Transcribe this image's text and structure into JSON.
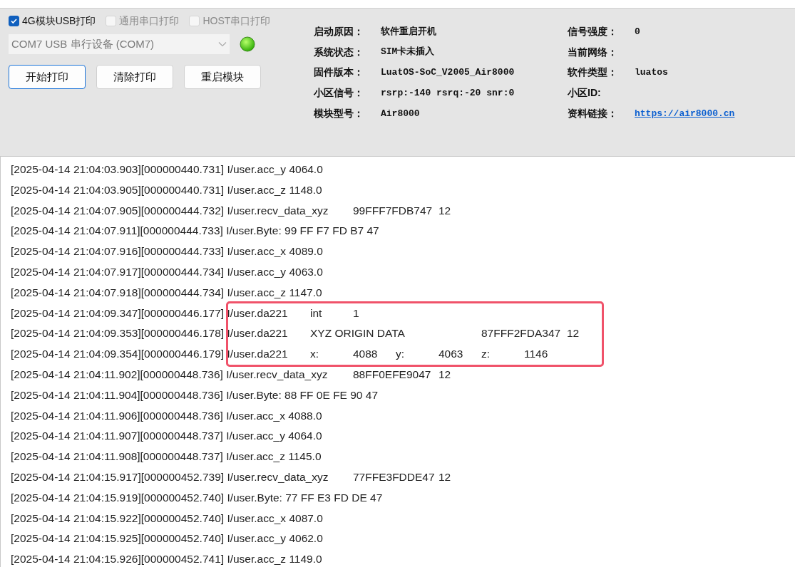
{
  "print_options": [
    {
      "label": "4G模块USB打印",
      "checked": true,
      "disabled": false
    },
    {
      "label": "通用串口打印",
      "checked": false,
      "disabled": true
    },
    {
      "label": "HOST串口打印",
      "checked": false,
      "disabled": true
    }
  ],
  "port_select": {
    "value": "COM7 USB 串行设备 (COM7)",
    "disabled": true
  },
  "status_led": {
    "on": true
  },
  "buttons": [
    {
      "label": "开始打印",
      "selected": true
    },
    {
      "label": "清除打印",
      "selected": false
    },
    {
      "label": "重启模块",
      "selected": false
    }
  ],
  "info": [
    {
      "label": "启动原因：",
      "value": "软件重启开机",
      "kind": "text"
    },
    {
      "label": "信号强度：",
      "value": "0",
      "kind": "text"
    },
    {
      "label": "系统状态：",
      "value": "SIM卡未插入",
      "kind": "text"
    },
    {
      "label": "当前网络：",
      "kind": "text"
    },
    {
      "label": "固件版本：",
      "value": "LuatOS-SoC_V2005_Air8000",
      "kind": "text"
    },
    {
      "label": "软件类型：",
      "value": "luatos",
      "kind": "text"
    },
    {
      "label": "小区信号：",
      "value": "rsrp:-140 rsrq:-20 snr:0",
      "kind": "text"
    },
    {
      "label": "小区ID:",
      "kind": "text"
    },
    {
      "label": "模块型号：",
      "value": "Air8000",
      "kind": "text"
    },
    {
      "label": "资料链接：",
      "value": "https://air8000.cn",
      "kind": "link"
    }
  ],
  "log": [
    {
      "text": "[2025-04-14 21:04:03.903][000000440.731] I/user.acc_y 4064.0",
      "highlighted": false
    },
    {
      "text": "[2025-04-14 21:04:03.905][000000440.731] I/user.acc_z 1148.0",
      "highlighted": false
    },
    {
      "text": "[2025-04-14 21:04:07.905][000000444.732] I/user.recv_data_xyz\t99FFF7FDB747\t12",
      "highlighted": false
    },
    {
      "text": "[2025-04-14 21:04:07.911][000000444.733] I/user.Byte: 99 FF F7 FD B7 47",
      "highlighted": false
    },
    {
      "text": "[2025-04-14 21:04:07.916][000000444.733] I/user.acc_x 4089.0",
      "highlighted": false
    },
    {
      "text": "[2025-04-14 21:04:07.917][000000444.734] I/user.acc_y 4063.0",
      "highlighted": false
    },
    {
      "text": "[2025-04-14 21:04:07.918][000000444.734] I/user.acc_z 1147.0",
      "highlighted": false
    },
    {
      "text": "[2025-04-14 21:04:09.347][000000446.177] I/user.da221\tint\t1",
      "highlighted": true
    },
    {
      "text": "[2025-04-14 21:04:09.353][000000446.178] I/user.da221\tXYZ ORIGIN DATA\t\t87FFF2FDA347\t12",
      "highlighted": true
    },
    {
      "text": "[2025-04-14 21:04:09.354][000000446.179] I/user.da221\tx:\t4088\ty:\t4063\tz:\t1146",
      "highlighted": true
    },
    {
      "text": "[2025-04-14 21:04:11.902][000000448.736] I/user.recv_data_xyz\t88FF0EFE9047\t12",
      "highlighted": false
    },
    {
      "text": "[2025-04-14 21:04:11.904][000000448.736] I/user.Byte: 88 FF 0E FE 90 47",
      "highlighted": false
    },
    {
      "text": "[2025-04-14 21:04:11.906][000000448.736] I/user.acc_x 4088.0",
      "highlighted": false
    },
    {
      "text": "[2025-04-14 21:04:11.907][000000448.737] I/user.acc_y 4064.0",
      "highlighted": false
    },
    {
      "text": "[2025-04-14 21:04:11.908][000000448.737] I/user.acc_z 1145.0",
      "highlighted": false
    },
    {
      "text": "[2025-04-14 21:04:15.917][000000452.739] I/user.recv_data_xyz\t77FFE3FDDE47\t12",
      "highlighted": false
    },
    {
      "text": "[2025-04-14 21:04:15.919][000000452.740] I/user.Byte: 77 FF E3 FD DE 47",
      "highlighted": false
    },
    {
      "text": "[2025-04-14 21:04:15.922][000000452.740] I/user.acc_x 4087.0",
      "highlighted": false
    },
    {
      "text": "[2025-04-14 21:04:15.925][000000452.740] I/user.acc_y 4062.0",
      "highlighted": false
    },
    {
      "text": "[2025-04-14 21:04:15.926][000000452.741] I/user.acc_z 1149.0",
      "highlighted": false
    }
  ]
}
